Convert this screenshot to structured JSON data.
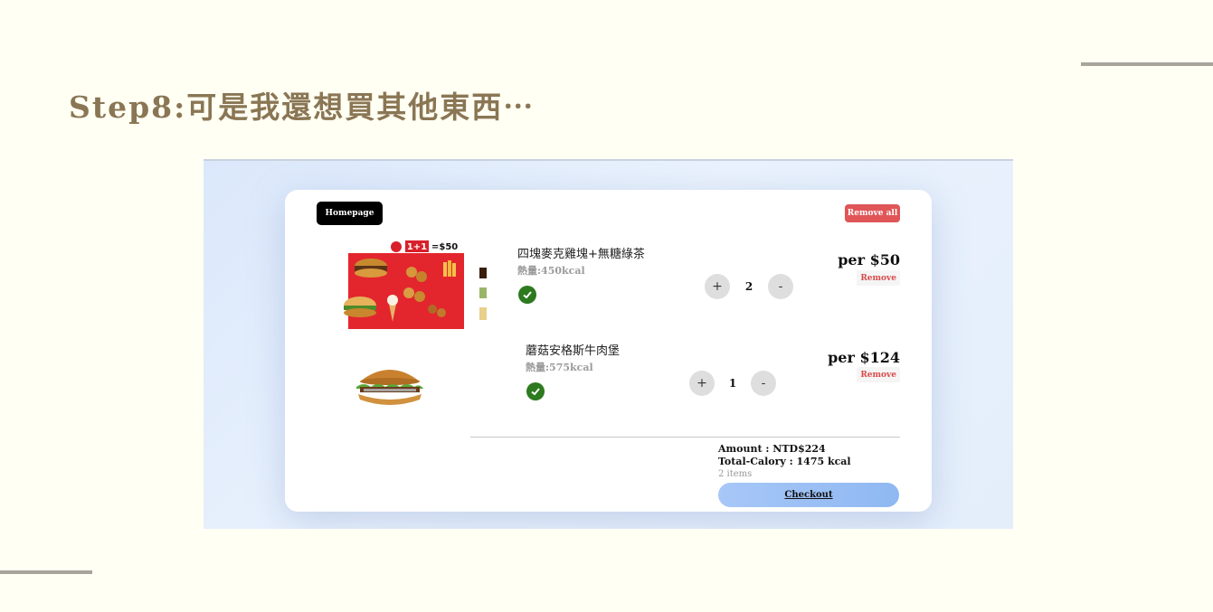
{
  "slide": {
    "title": "Step8:可是我還想買其他東西⋯"
  },
  "cart": {
    "homepage_label": "Homepage",
    "remove_all_label": "Remove all",
    "items": [
      {
        "name": "四塊麥克雞塊+無糖綠茶",
        "calories": "熱量:450kcal",
        "quantity": "2",
        "price": "per $50",
        "remove_label": "Remove",
        "plus_label": "+",
        "minus_label": "-",
        "promo": {
          "badge": "1+1",
          "price": "=$50"
        }
      },
      {
        "name": "蘑菇安格斯牛肉堡",
        "calories": "熱量:575kcal",
        "quantity": "1",
        "price": "per $124",
        "remove_label": "Remove",
        "plus_label": "+",
        "minus_label": "-"
      }
    ],
    "summary": {
      "amount": "Amount : NTD$224",
      "total_calory": "Total-Calory : 1475 kcal",
      "items_count": "2 items"
    },
    "checkout_label": "Checkout"
  },
  "colors": {
    "background": "#fffff3",
    "title": "#8a7654",
    "remove_all": "#e05557",
    "check": "#2d7a1f",
    "checkout": "#9dc0f5"
  }
}
